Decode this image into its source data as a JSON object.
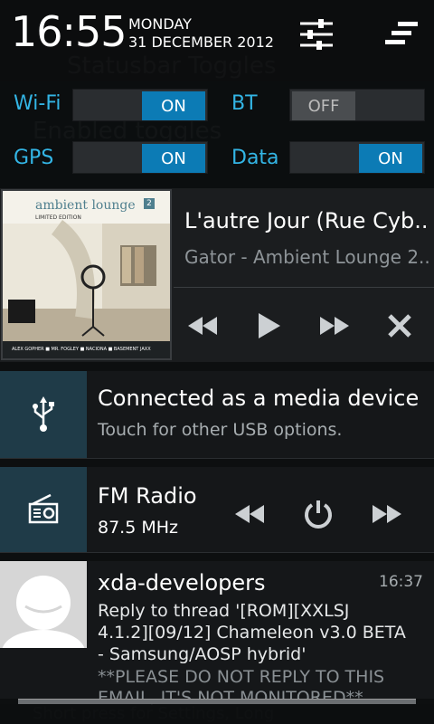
{
  "background": {
    "screen_title": "Statusbar Toggles",
    "item1": "Enabled toggles",
    "footer_hint": "Short press for Settings, Long"
  },
  "header": {
    "time": "16:55",
    "day": "MONDAY",
    "date": "31 DECEMBER 2012",
    "settings_icon": "sliders-icon",
    "clear_icon": "clear-all-icon"
  },
  "toggles": [
    {
      "label": "Wi-Fi",
      "state": "ON"
    },
    {
      "label": "BT",
      "state": "OFF"
    },
    {
      "label": "GPS",
      "state": "ON"
    },
    {
      "label": "Data",
      "state": "ON"
    }
  ],
  "music": {
    "title": "L'autre Jour (Rue Cyb..",
    "subtitle": "Gator - Ambient Lounge 2..",
    "album_art_text": "ambient lounge",
    "album_art_number": "2",
    "album_edition": "LIMITED EDITION",
    "album_artists": "ALEX GOPHER ■ MR. FOGLEY ■ NACIONA ■ BASEMENT JAXX"
  },
  "usb": {
    "title": "Connected as a media device",
    "text": "Touch for other USB options."
  },
  "radio": {
    "title": "FM Radio",
    "frequency": "87.5 MHz"
  },
  "xda": {
    "title": "xda-developers",
    "time": "16:37",
    "line1": "Reply to thread '[ROM][XXLSJ",
    "line2": "4.1.2][09/12] Chameleon v3.0 BETA",
    "line3": "- Samsung/AOSP hybrid'",
    "line4": "**PLEASE DO NOT REPLY TO THIS",
    "line5": "EMAIL, IT'S NOT MONITORED**"
  },
  "colors": {
    "accent": "#33b5e5",
    "switch_on": "#0c7bb5",
    "icon_box": "#1f3b48"
  }
}
